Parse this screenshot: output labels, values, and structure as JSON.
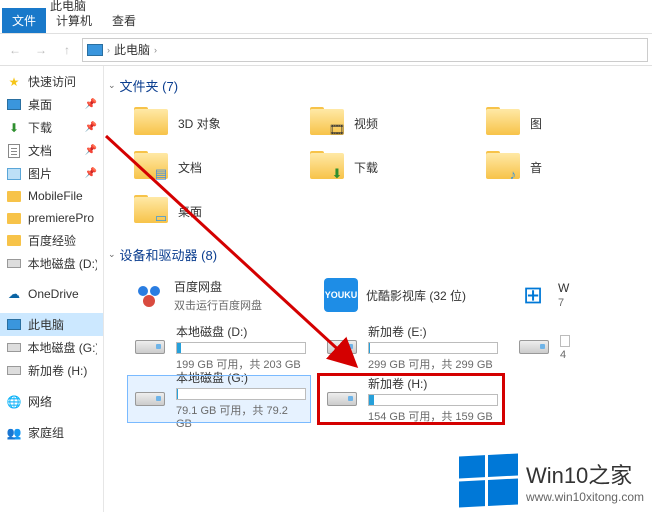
{
  "window": {
    "title": "此电脑"
  },
  "ribbon": {
    "file": "文件",
    "computer": "计算机",
    "view": "查看"
  },
  "breadcrumb": {
    "location": "此电脑"
  },
  "sidebar": {
    "quick": {
      "label": "快速访问"
    },
    "pinned": [
      {
        "label": "桌面"
      },
      {
        "label": "下载"
      },
      {
        "label": "文档"
      },
      {
        "label": "图片"
      }
    ],
    "items": [
      {
        "label": "MobileFile"
      },
      {
        "label": "premierePro"
      },
      {
        "label": "百度经验"
      },
      {
        "label": "本地磁盘 (D:)"
      }
    ],
    "onedrive": "OneDrive",
    "thispc": "此电脑",
    "drives": [
      {
        "label": "本地磁盘 (G:)"
      },
      {
        "label": "新加卷 (H:)"
      }
    ],
    "network": "网络",
    "homegroup": "家庭组"
  },
  "content": {
    "folders": {
      "header": "文件夹 (7)",
      "items": [
        {
          "label": "3D 对象",
          "overlay": ""
        },
        {
          "label": "视频",
          "overlay": "🎞"
        },
        {
          "label": "图",
          "overlay": ""
        },
        {
          "label": "文档",
          "overlay": "📄"
        },
        {
          "label": "下载",
          "overlay": "⬇"
        },
        {
          "label": "音",
          "overlay": "♪"
        },
        {
          "label": "桌面",
          "overlay": "🖥"
        }
      ]
    },
    "drives": {
      "header": "设备和驱动器 (8)",
      "apps": [
        {
          "name": "百度网盘",
          "sub": "双击运行百度网盘"
        },
        {
          "name": "优酷影视库 (32 位)",
          "sub": ""
        },
        {
          "name": "W",
          "sub": "7"
        }
      ],
      "disks": [
        {
          "name": "本地磁盘 (D:)",
          "free": "199 GB 可用，共 203 GB",
          "fill": 2
        },
        {
          "name": "新加卷 (E:)",
          "free": "299 GB 可用，共 299 GB",
          "fill": 1
        },
        {
          "name": "",
          "free": "4",
          "fill": 0
        },
        {
          "name": "本地磁盘 (G:)",
          "free": "79.1 GB 可用，共 79.2 GB",
          "fill": 1,
          "selected": true
        },
        {
          "name": "新加卷 (H:)",
          "free": "154 GB 可用，共 159 GB",
          "fill": 3,
          "highlighted": true
        }
      ]
    }
  },
  "watermark": {
    "brand": "Win10之家",
    "url": "www.win10xitong.com"
  }
}
